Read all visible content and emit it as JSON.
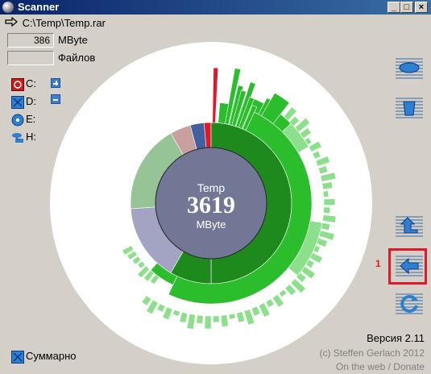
{
  "window": {
    "title": "Scanner",
    "btn_min": "_",
    "btn_max": "□",
    "btn_close": "×"
  },
  "path": "C:\\Temp\\Temp.rar",
  "stats": {
    "size_value": "386",
    "size_unit": "MByte",
    "files_value": "",
    "files_label": "Файлов"
  },
  "drives": [
    {
      "label": "C:",
      "icon": "drive-c-icon"
    },
    {
      "label": "D:",
      "icon": "drive-d-icon"
    },
    {
      "label": "E:",
      "icon": "cd-drive-icon"
    },
    {
      "label": "H:",
      "icon": "network-drive-icon"
    }
  ],
  "center": {
    "name": "Temp",
    "value": "3619",
    "unit": "MByte"
  },
  "marker": "1",
  "summary_label": "Суммарно",
  "version": "Версия 2.11",
  "copyright": "(c) Steffen Gerlach 2012",
  "web_link": "On the web / Donate",
  "colors": {
    "center": "#727795",
    "ring_gray": "#a3a4c4",
    "dark_green": "#1e8a1e",
    "green": "#2bbd2b",
    "light_green": "#8ce08c",
    "highlight": "#e0182a"
  }
}
